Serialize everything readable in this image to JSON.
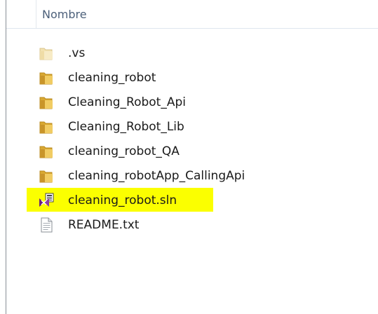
{
  "header": {
    "column_name": "Nombre"
  },
  "files": [
    {
      "name": ".vs",
      "type": "folder",
      "icon": "folder-icon",
      "variant": "faded"
    },
    {
      "name": "cleaning_robot",
      "type": "folder",
      "icon": "folder-icon"
    },
    {
      "name": "Cleaning_Robot_Api",
      "type": "folder",
      "icon": "folder-icon"
    },
    {
      "name": "Cleaning_Robot_Lib",
      "type": "folder",
      "icon": "folder-icon"
    },
    {
      "name": "cleaning_robot_QA",
      "type": "folder",
      "icon": "folder-icon"
    },
    {
      "name": "cleaning_robotApp_CallingApi",
      "type": "folder",
      "icon": "folder-icon"
    },
    {
      "name": "cleaning_robot.sln",
      "type": "solution",
      "icon": "visual-studio-solution-icon",
      "highlighted": true
    },
    {
      "name": "README.txt",
      "type": "text",
      "icon": "text-file-icon"
    }
  ],
  "colors": {
    "highlight": "#fbff00",
    "folder": "#e9c25a",
    "header_text": "#4c607a"
  }
}
